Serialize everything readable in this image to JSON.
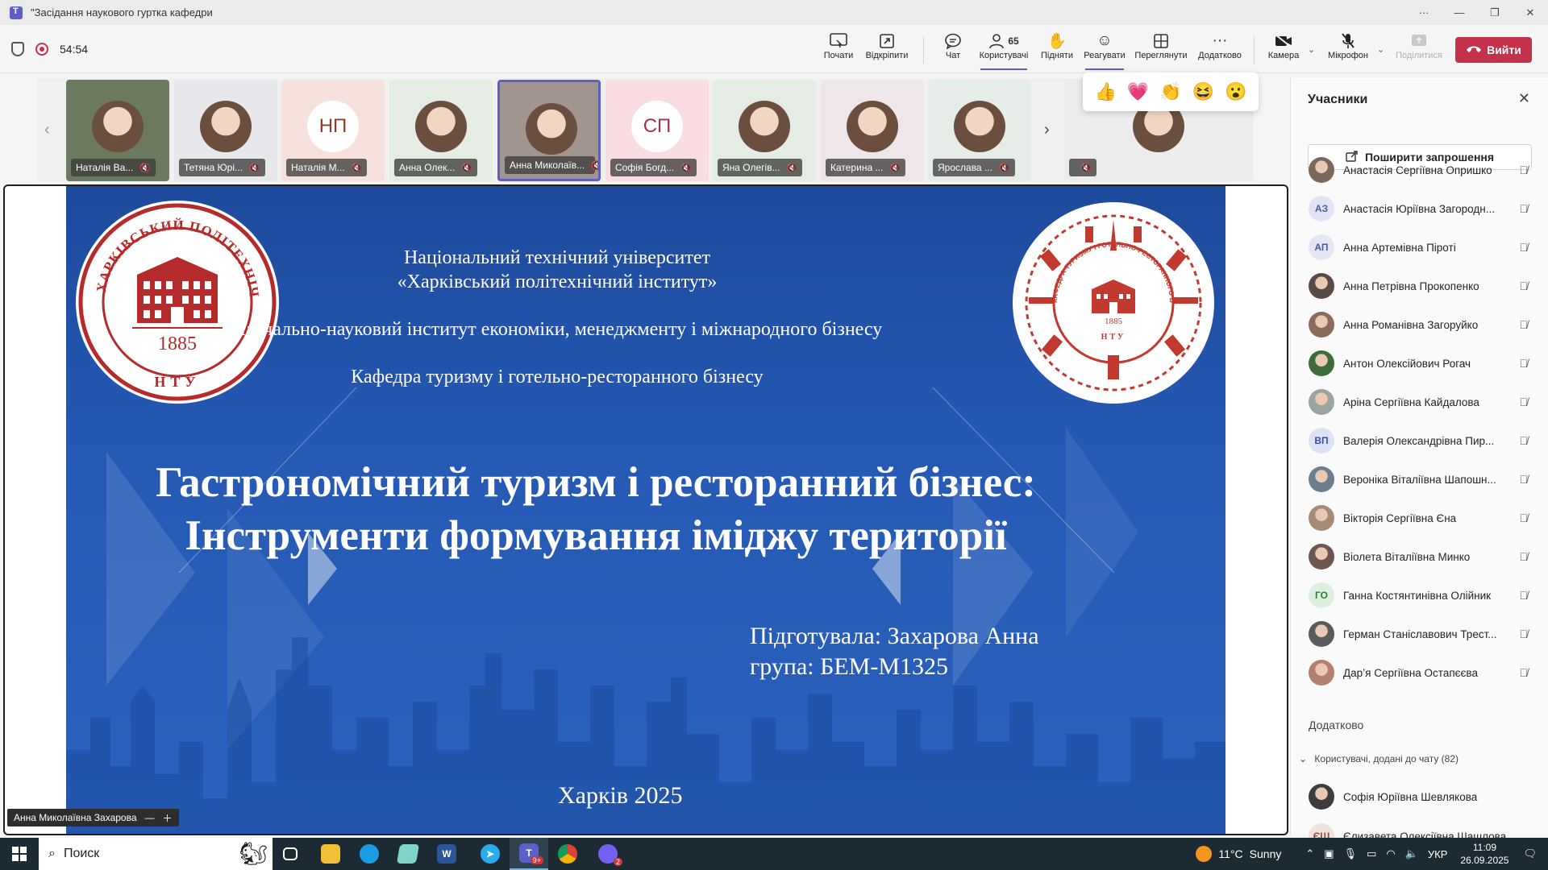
{
  "window": {
    "title": "\"Засідання наукового гуртка кафедри",
    "controls": [
      "···",
      "—",
      "❐",
      "✕"
    ]
  },
  "meeting": {
    "timer": "54:54",
    "toolbar": {
      "start_label": "Почати",
      "unpin_label": "Відкріпити",
      "chat_label": "Чат",
      "users_label": "Користувачі",
      "users_count": "65",
      "raise_label": "Підняти",
      "react_label": "Реагувати",
      "view_label": "Переглянути",
      "more_label": "Додатково",
      "camera_label": "Камера",
      "mic_label": "Мікрофон",
      "share_label": "Поділитися",
      "leave_label": "Вийти"
    },
    "reactions": [
      "👍",
      "💗",
      "👏",
      "😆",
      "😮"
    ]
  },
  "participants_strip": [
    {
      "name": "Наталія Ва...",
      "type": "photo",
      "bg": "#6b7a5e"
    },
    {
      "name": "Тетяна Юрі...",
      "type": "photo",
      "bg": "#e8e8ec"
    },
    {
      "name": "Наталія М...",
      "type": "initials",
      "initials": "НП",
      "bg": "#f7e1dc",
      "fg": "#8a3b2a"
    },
    {
      "name": "Анна Олек...",
      "type": "photo",
      "bg": "#e5ece4"
    },
    {
      "name": "Анна Миколаїв...",
      "type": "photo",
      "bg": "#a2958f"
    },
    {
      "name": "Софія Богд...",
      "type": "initials",
      "initials": "СП",
      "bg": "#f9dde3",
      "fg": "#a0334f"
    },
    {
      "name": "Яна Олегів...",
      "type": "photo",
      "bg": "#e4ece4"
    },
    {
      "name": "Катерина ...",
      "type": "photo",
      "bg": "#efe6ea"
    },
    {
      "name": "Ярослава ...",
      "type": "photo",
      "bg": "#e6ece8"
    },
    {
      "name": "",
      "type": "photo",
      "bg": "#ececec"
    }
  ],
  "slide": {
    "line1": "Національний технічний університет",
    "line2": "«Харківський політехнічний інститут»",
    "line3": "Навчально-науковий інститут економіки, менеджменту і міжнародного бізнесу",
    "line4": "Кафедра туризму і готельно-ресторанного бізнесу",
    "title1": "Гастрономічний туризм і ресторанний бізнес:",
    "title2": "Інструменти формування іміджу території",
    "author": "Підготувала: Захарова Анна",
    "group": "група: БЕМ-М1325",
    "city": "Харків 2025",
    "seal_left_top": "ХАРКІВСЬКИЙ ПОЛІТЕХНІЧНИЙ ІНСТИТУТ",
    "seal_left_year": "1885",
    "seal_left_bottom": "НТУ",
    "seal_right_text": "КАФЕДРА ТУРИЗМУ І ГОТЕЛЬНО-РЕСТОРАННОГО БІЗНЕСУ · ХАРКІВСЬКИЙ ПОЛІТЕХНІЧНИЙ ІНСТИТУТ",
    "seal_right_year": "1885",
    "seal_right_bottom": "НТУ"
  },
  "presenter_tag": "Анна Миколаївна Захарова",
  "panel": {
    "title": "Учасники",
    "invite_label": "Поширити запрошення",
    "participants": [
      {
        "name": "Анастасія Сергіївна Опришко",
        "type": "photo",
        "bg": "#7a6a5e"
      },
      {
        "name": "Анастасія Юріївна Загородн...",
        "type": "initials",
        "initials": "АЗ",
        "bg": "#e1e4f4",
        "fg": "#4f5a9e"
      },
      {
        "name": "Анна Артемівна Піроті",
        "type": "initials",
        "initials": "АП",
        "bg": "#e4e6f3",
        "fg": "#4f5a9e"
      },
      {
        "name": "Анна Петрівна Прокопенко",
        "type": "photo",
        "bg": "#5a4a44"
      },
      {
        "name": "Анна Романівна Загоруйко",
        "type": "photo",
        "bg": "#8c6a5c"
      },
      {
        "name": "Антон Олексійович Рогач",
        "type": "photo",
        "bg": "#3e6b3a"
      },
      {
        "name": "Аріна Сергіївна Кайдалова",
        "type": "photo",
        "bg": "#9aa4a0"
      },
      {
        "name": "Валерія Олександрівна Пир...",
        "type": "initials",
        "initials": "ВП",
        "bg": "#dde3f5",
        "fg": "#3b4f9e"
      },
      {
        "name": "Вероніка Віталіївна Шапошн...",
        "type": "photo",
        "bg": "#6f7e8c"
      },
      {
        "name": "Вікторія Сергіївна Єна",
        "type": "photo",
        "bg": "#a58a76"
      },
      {
        "name": "Віолета Віталіївна Минко",
        "type": "photo",
        "bg": "#6e5650"
      },
      {
        "name": "Ганна Костянтинівна Олійник",
        "type": "initials",
        "initials": "ГО",
        "bg": "#ddf0df",
        "fg": "#2f7a3b"
      },
      {
        "name": "Герман Станіславович Трест...",
        "type": "photo",
        "bg": "#5b5b5b"
      },
      {
        "name": "Дар’я Сергіївна Остапєєва",
        "type": "photo",
        "bg": "#b38070"
      }
    ],
    "more_section": "Додатково",
    "chat_section": "Користувачі, додані до чату (82)",
    "chat_participants": [
      {
        "name": "Софія Юріївна Шевлякова",
        "type": "photo",
        "bg": "#3d3d3d"
      },
      {
        "name": "Єлизавета Олексіївна Шашлова",
        "type": "initials",
        "initials": "ЄШ",
        "bg": "#f0e2dc",
        "fg": "#8a4a3a"
      }
    ]
  },
  "taskbar": {
    "search_placeholder": "Поиск",
    "weather_temp": "11°C",
    "weather_desc": "Sunny",
    "lang": "УКР",
    "time": "11:09",
    "date": "26.09.2025",
    "teams_badge": "9+",
    "viber_badge": "2"
  }
}
